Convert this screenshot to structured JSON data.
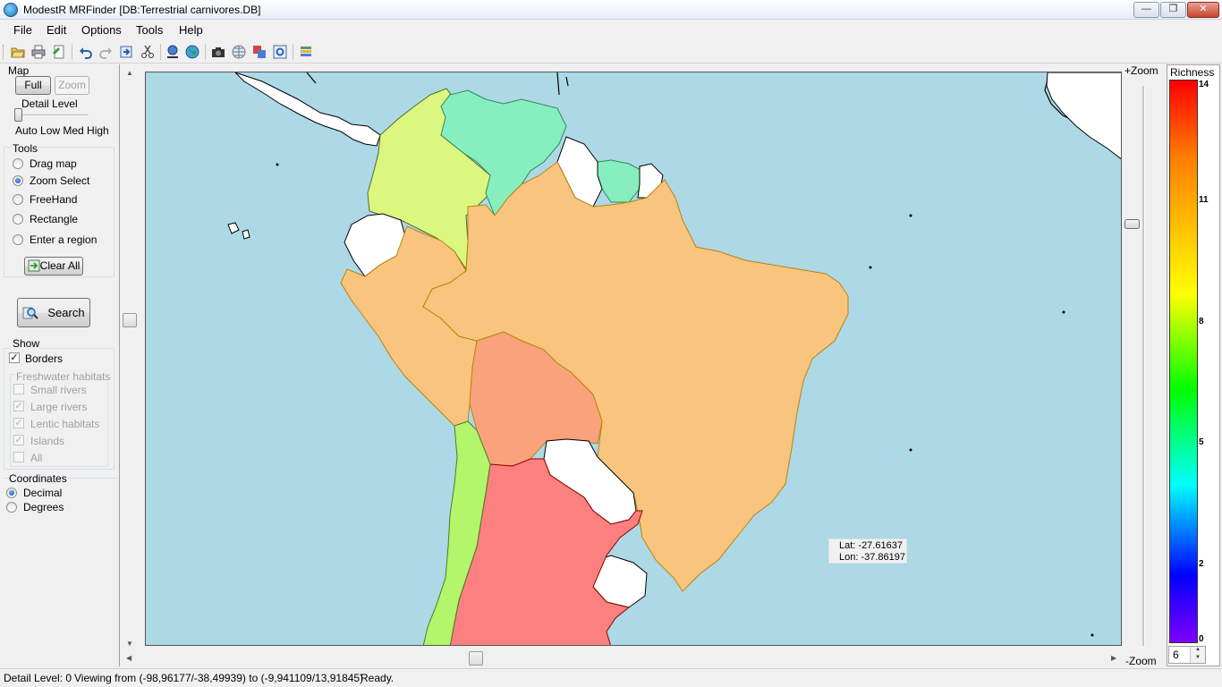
{
  "window": {
    "title": "ModestR MRFinder  [DB:Terrestrial carnivores.DB]",
    "minimize": "—",
    "maximize": "❐",
    "close": "✕"
  },
  "menu": [
    "File",
    "Edit",
    "Options",
    "Tools",
    "Help"
  ],
  "toolbar": {
    "icons": [
      "open-icon",
      "print-icon",
      "export-icon",
      "undo-icon",
      "redo-icon",
      "forward-icon",
      "cut-icon",
      "search-map-icon",
      "globe-icon",
      "camera-icon",
      "grid-icon",
      "layers-icon",
      "settings-icon",
      "legend-icon"
    ]
  },
  "map_group": {
    "title": "Map",
    "full_button": "Full",
    "zoom_button": "Zoom",
    "detail_label": "Detail Level",
    "detail_levels": "Auto Low Med High",
    "detail_value": 0
  },
  "tools_group": {
    "title": "Tools",
    "options": [
      {
        "label": "Drag map",
        "selected": false
      },
      {
        "label": "Zoom Select",
        "selected": true
      },
      {
        "label": "FreeHand",
        "selected": false
      },
      {
        "label": "Rectangle",
        "selected": false
      },
      {
        "label": "Enter a region",
        "selected": false
      }
    ],
    "clear_button": "Clear All"
  },
  "search_button": "Search",
  "show_group": {
    "title": "Show",
    "borders": {
      "label": "Borders",
      "checked": true
    },
    "freshwater_title": "Freshwater habitats",
    "freshwater": [
      {
        "label": "Small rivers",
        "checked": false
      },
      {
        "label": "Large rivers",
        "checked": true
      },
      {
        "label": "Lentic habitats",
        "checked": true
      },
      {
        "label": "Islands",
        "checked": true
      },
      {
        "label": "All",
        "checked": false
      }
    ]
  },
  "coordinates_group": {
    "title": "Coordinates",
    "options": [
      {
        "label": "Decimal",
        "selected": true
      },
      {
        "label": "Degrees",
        "selected": false
      }
    ]
  },
  "map": {
    "lat_label": "Lat: -27.61637",
    "lon_label": "Lon: -37.86197",
    "ocean_color": "#add8e6",
    "regions": [
      {
        "name": "colombia",
        "color": "#dcf780"
      },
      {
        "name": "venezuela",
        "color": "#87efbf"
      },
      {
        "name": "guyana",
        "color": "#87efbf"
      },
      {
        "name": "brazil",
        "color": "#f8c47e"
      },
      {
        "name": "peru",
        "color": "#f8c47e"
      },
      {
        "name": "bolivia",
        "color": "#f9a27c"
      },
      {
        "name": "chile",
        "color": "#b3f56b"
      },
      {
        "name": "argentina",
        "color": "#fd8080"
      },
      {
        "name": "no-data",
        "color": "#ffffff"
      }
    ]
  },
  "zoom": {
    "plus_label": "+Zoom",
    "minus_label": "-Zoom"
  },
  "legend": {
    "title": "Richness",
    "ticks": [
      "14",
      "11",
      "8",
      "5",
      "2",
      "0"
    ],
    "spinner_value": "6"
  },
  "status": {
    "detail": "Detail Level: 0",
    "viewing": "Viewing from (-98,96177/-38,49939) to (-9,941109/13,91845)",
    "state": "Ready."
  }
}
